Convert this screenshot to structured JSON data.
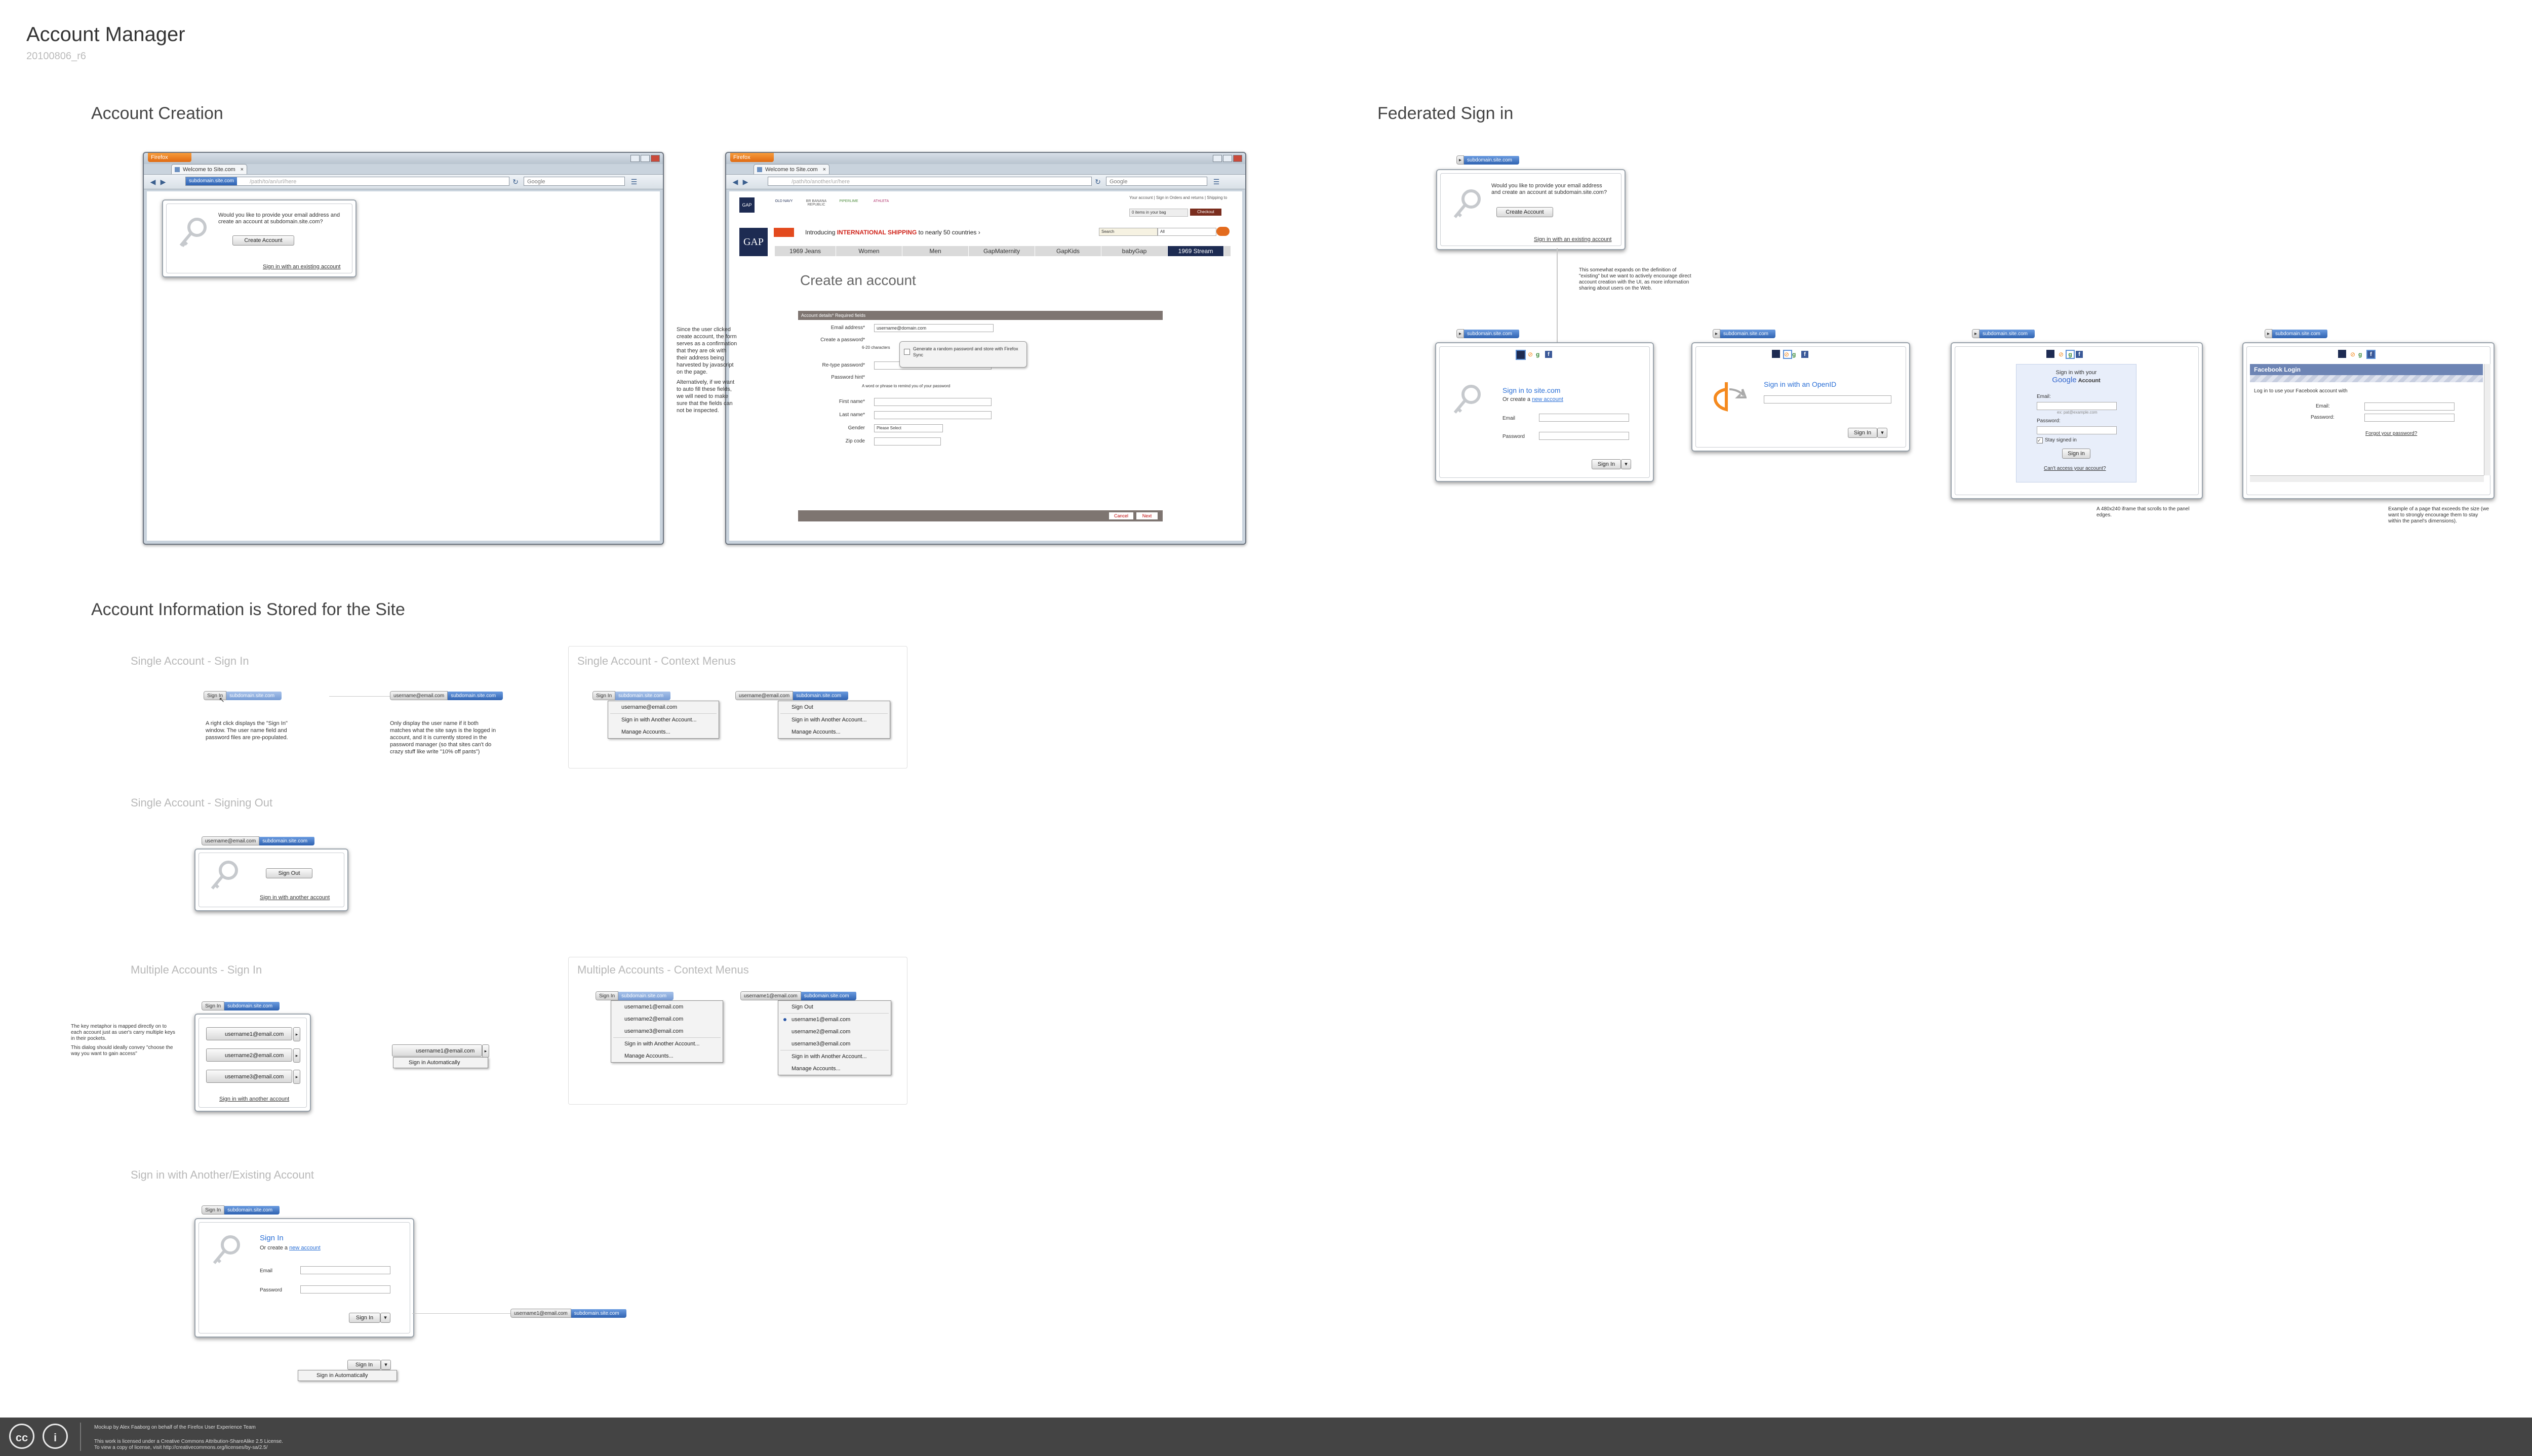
{
  "header": {
    "title": "Account Manager",
    "version": "20100806_r6"
  },
  "sections": {
    "creation": "Account Creation",
    "federated": "Federated Sign in",
    "stored": "Account Information is Stored for the Site"
  },
  "sub_sections": {
    "single_signin": "Single Account - Sign In",
    "single_context": "Single Account - Context Menus",
    "single_signout": "Single Account - Signing Out",
    "multi_signin": "Multiple Accounts - Sign In",
    "multi_context": "Multiple Accounts - Context Menus",
    "other_existing": "Sign in with Another/Existing Account"
  },
  "browser": {
    "firefox_label": "Firefox",
    "tab1": "Welcome to Site.com",
    "tab2": "Welcome to Site.com",
    "url_placeholder": "/path/to/an/url/here",
    "url_placeholder2": "/path/to/another/ur/here",
    "search_placeholder": "Google",
    "identity_domain": "subdomain.site.com"
  },
  "creation_prompt": {
    "message": "Would you like to provide your email address and create an account at subdomain.site.com?",
    "create_button": "Create Account",
    "existing_link": "Sign in with an existing account"
  },
  "gap_page": {
    "brands": [
      "GAP",
      "OLD NAVY",
      "BR BANANA REPUBLIC",
      "PIPERLIME",
      "ATHLETA"
    ],
    "account_links": "Your account | Sign in  Orders and returns | Shipping to",
    "bag": "0 items in your bag",
    "checkout": "Checkout",
    "banner_prefix": "Introducing",
    "banner_highlight": "INTERNATIONAL SHIPPING",
    "banner_suffix": "to nearly 50 countries ›",
    "nav": [
      "1969 Jeans",
      "Women",
      "Men",
      "GapMaternity",
      "GapKids",
      "babyGap",
      "1969 Stream"
    ],
    "search_label": "Search",
    "search_scope": "All",
    "heading": "Create an account",
    "details_bar": "Account details* Required fields",
    "email_label": "Email address*",
    "email_value": "username@domain.com",
    "password_label": "Create a password*",
    "password_hint": "6-20 characters",
    "retype_label": "Re-type password*",
    "hint_label": "Password hint*",
    "hint_desc": "A word or phrase to remind you of your password",
    "first_label": "First name*",
    "last_label": "Last name*",
    "gender_label": "Gender",
    "gender_value": "Please Select",
    "zip_label": "Zip code",
    "tooltip": "Generate a random password and store with Firefox Sync",
    "cancel": "Cancel",
    "next": "Next"
  },
  "creation_note": {
    "p1": "Since the user clicked create account, the form serves as a confirmation that they are ok with their address being harvested by javascript on the page.",
    "p2": "Alternatively, if we want to auto fill these fields, we will need to make sure that the fields can not be inspected."
  },
  "federated": {
    "create_message": "Would you like to provide your email address and create an account at subdomain.site.com?",
    "create_button": "Create Account",
    "existing_link": "Sign in with an existing account",
    "note": "This somewhat expands on the definition of \"existing\" but we want to actively encourage direct account creation with the UI, as more information sharing about users on the Web.",
    "site_title": "Sign in to site.com",
    "site_sub_prefix": "Or create a",
    "site_sub_link": "new account",
    "email_label": "Email",
    "password_label": "Password",
    "signin_button": "Sign In",
    "openid_title": "Sign in with an OpenID",
    "google_title_pre": "Sign in with your",
    "google_brand": "Google",
    "google_title_post": "Account",
    "google_email_label": "Email:",
    "google_email_value": "ex: pat@example.com",
    "google_password_label": "Password:",
    "google_stay": "Stay signed in",
    "google_signin": "Sign in",
    "google_help": "Can't access your account?",
    "google_note": "A 480x240 iframe that scrolls to the panel edges.",
    "fb_title": "Facebook Login",
    "fb_intro": "Log in to use your Facebook account with",
    "fb_email": "Email:",
    "fb_password": "Password:",
    "fb_forgot": "Forgot your password?",
    "fb_note": "Example of a page that exceeds the size (we want to strongly encourage them to stay within the panel's dimensions)."
  },
  "stored": {
    "signin_button": "Sign In",
    "username": "username@email.com",
    "single_note1": "A right click displays the \"Sign In\" window. The user name field and password files are pre-populated.",
    "single_note2": "Only display the user name if it both matches what the site says is the logged in account, and it is currently stored in the password manager (so that sites can't do crazy stuff like write \"10% off pants\")",
    "ctx1": [
      "username@email.com",
      "Sign in with Another Account...",
      "Manage Accounts..."
    ],
    "ctx2": [
      "Sign Out",
      "Sign in with Another Account...",
      "Manage Accounts..."
    ],
    "signout_button": "Sign Out",
    "signout_link": "Sign in with another account",
    "multi_accounts": [
      "username1@email.com",
      "username2@email.com",
      "username3@email.com"
    ],
    "multi_link": "Sign in with another account",
    "multi_note1": "The key metaphor is mapped directly on to each account just as user's carry multiple keys in their pockets.",
    "multi_note2": "This dialog should ideally convey \"choose the way you want to gain access\"",
    "auto_user": "username1@email.com",
    "auto_label": "Sign in Automatically",
    "mctx1": [
      "username1@email.com",
      "username2@email.com",
      "username3@email.com",
      "Sign in with Another Account...",
      "Manage Accounts..."
    ],
    "mctx2": [
      "Sign Out",
      "username1@email.com",
      "username2@email.com",
      "username3@email.com",
      "Sign in with Another Account...",
      "Manage Accounts..."
    ],
    "other_title": "Sign In",
    "other_sub_prefix": "Or create a",
    "other_sub_link": "new account",
    "other_email": "Email",
    "other_password": "Password",
    "other_signin": "Sign In",
    "other_auto": "Sign in Automatically",
    "other_result_user": "username1@email.com"
  },
  "footer": {
    "line1": "Mockup by Alex Faaborg on behalf of the Firefox User Experience Team",
    "line2": "This work is licensed under a Creative Commons Attribution-ShareAlike 2.5 License.",
    "line3": "To view a copy of license, visit http://creativecommons.org/licenses/by-sa/2.5/",
    "cc": "cc",
    "by": "i"
  },
  "colors": {
    "identity_blue": "#2f63b3",
    "link_blue": "#2a6fd6",
    "footer_bg": "#444444",
    "gap_navy": "#1d2b52"
  }
}
